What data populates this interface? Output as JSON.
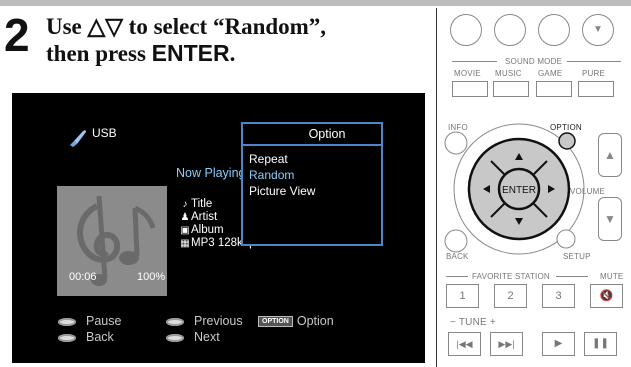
{
  "step": {
    "number": "2",
    "line1_prefix": "Use ",
    "line1_arrows": "△▽",
    "line1_suffix": " to select “Random”,",
    "line2_prefix": "then press ",
    "line2_key": "ENTER",
    "line2_suffix": "."
  },
  "screen": {
    "source": "USB",
    "now_playing": "Now Playing",
    "title": "Title",
    "artist": "Artist",
    "album": "Album",
    "format": "MP3 128kbps",
    "time": "00:06",
    "progress_percent": "100%",
    "legend": {
      "pause": "Pause",
      "back": "Back",
      "previous": "Previous",
      "next": "Next",
      "option_badge": "OPTION",
      "option": "Option"
    }
  },
  "popup": {
    "title": "Option",
    "items": [
      "Repeat",
      "Random",
      "Picture View"
    ],
    "selected_index": 1
  },
  "remote": {
    "sound_mode": "SOUND MODE",
    "movie": "MOVIE",
    "music": "MUSIC",
    "game": "GAME",
    "pure": "PURE",
    "info": "INFO",
    "option": "OPTION",
    "enter": "ENTER",
    "volume": "VOLUME",
    "back": "BACK",
    "setup": "SETUP",
    "favorite_station": "FAVORITE STATION",
    "mute": "MUTE",
    "fav1": "1",
    "fav2": "2",
    "fav3": "3",
    "tune": "TUNE",
    "tune_minus": "−",
    "tune_plus": "+"
  },
  "colors": {
    "highlight_text": "#87cefa",
    "popup_border": "#4f86c9",
    "screen_bg": "#000000",
    "dpad": "#c8c8c8"
  }
}
